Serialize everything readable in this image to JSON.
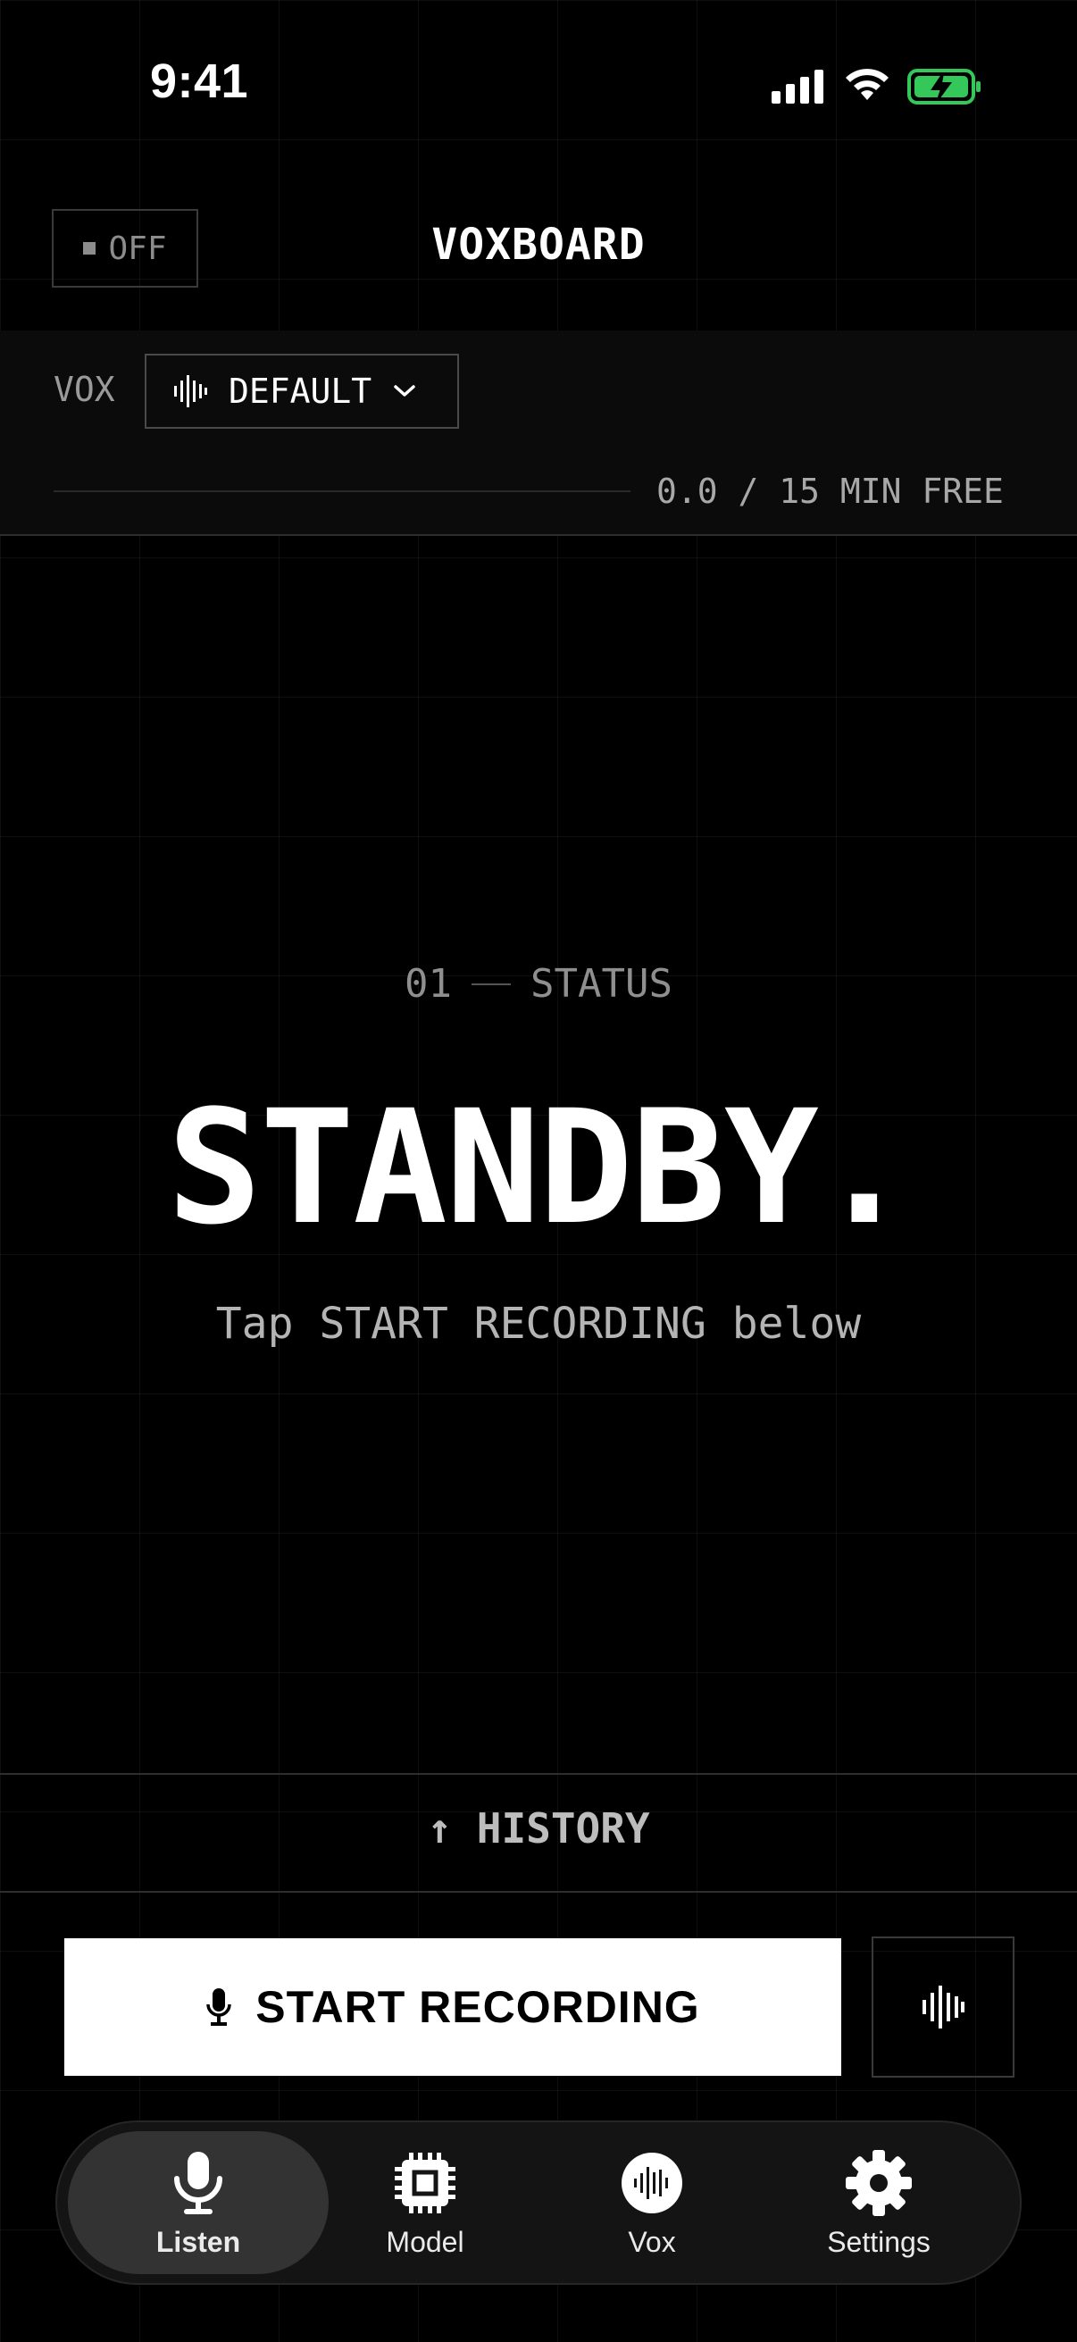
{
  "status_bar": {
    "time": "9:41"
  },
  "header": {
    "toggle_label": "OFF",
    "title": "VOXBOARD"
  },
  "vox": {
    "label": "VOX",
    "selected": "DEFAULT",
    "usage": "0.0 / 15 MIN FREE",
    "usage_fraction": 0.0
  },
  "status": {
    "number": "01",
    "label": "STATUS",
    "headline": "STANDBY.",
    "hint": "Tap START RECORDING below"
  },
  "history": {
    "label": "HISTORY"
  },
  "record": {
    "label": "START RECORDING"
  },
  "tabs": [
    {
      "label": "Listen",
      "icon": "mic-icon",
      "active": true
    },
    {
      "label": "Model",
      "icon": "chip-icon",
      "active": false
    },
    {
      "label": "Vox",
      "icon": "waveform-circle-icon",
      "active": false
    },
    {
      "label": "Settings",
      "icon": "gear-icon",
      "active": false
    }
  ],
  "colors": {
    "background": "#000000",
    "accent": "#ffffff",
    "battery": "#34c759"
  }
}
